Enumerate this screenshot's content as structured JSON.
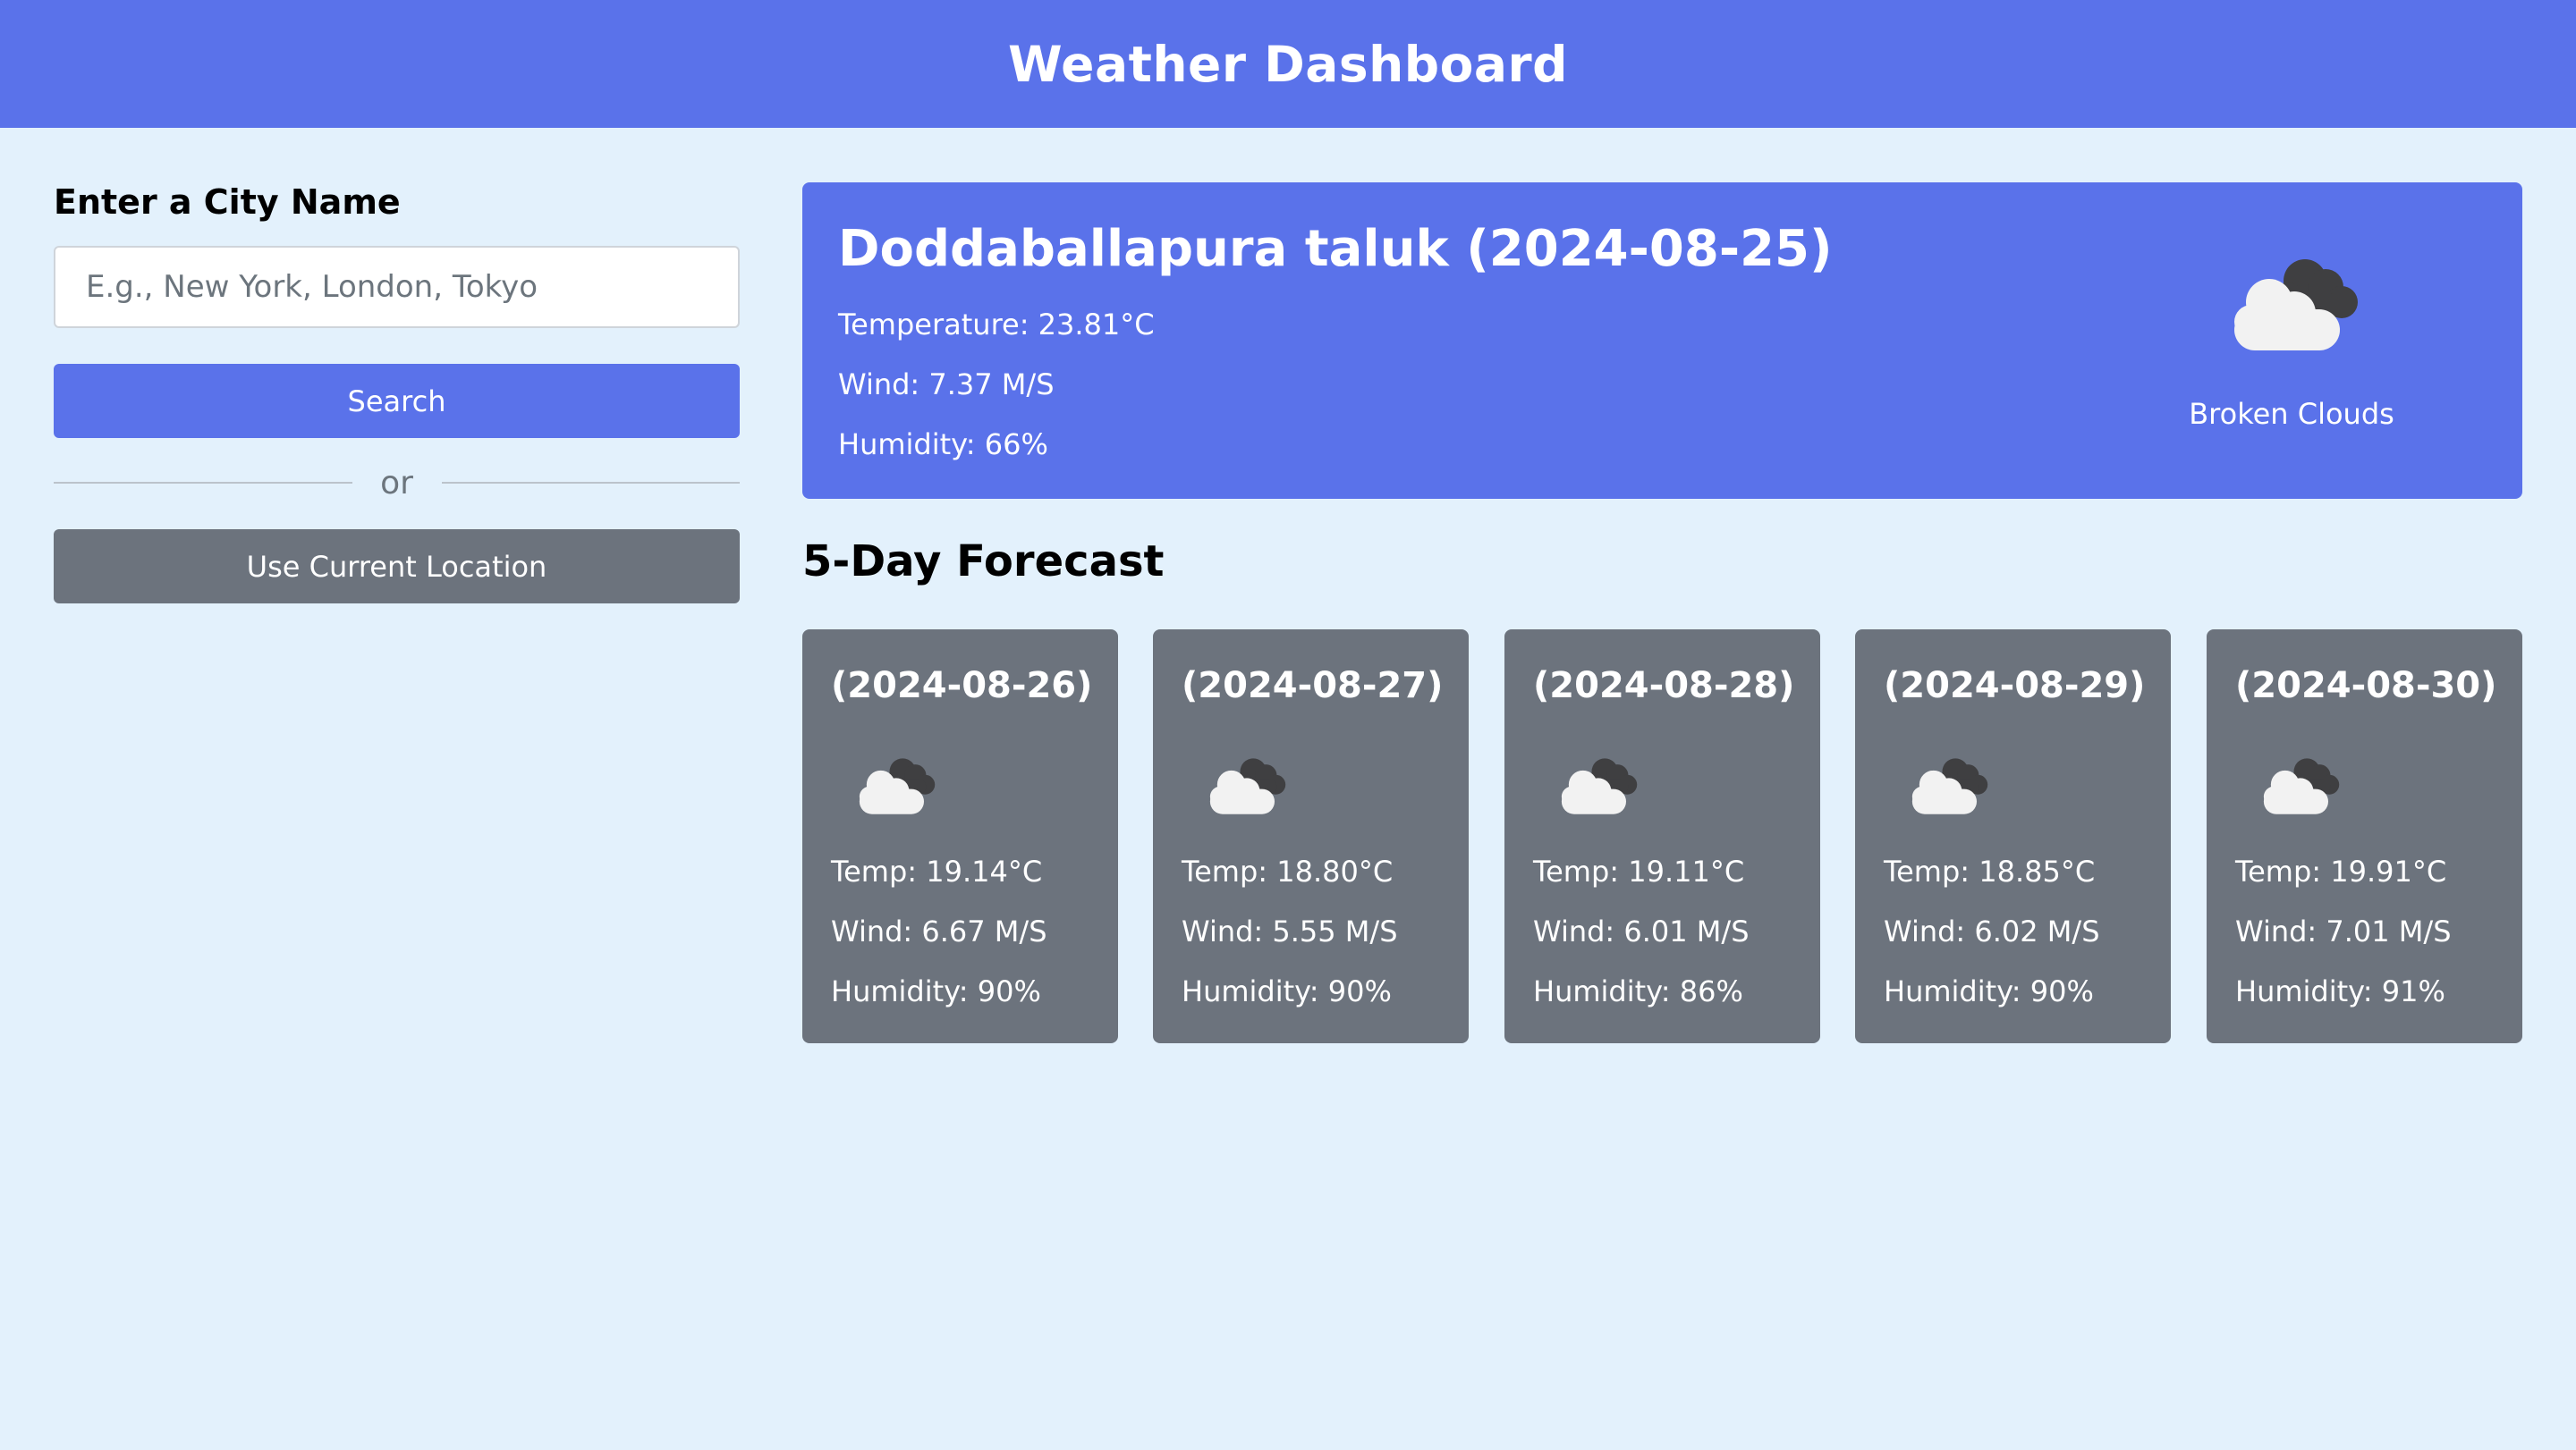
{
  "header": {
    "title": "Weather Dashboard"
  },
  "sidebar": {
    "label": "Enter a City Name",
    "input_placeholder": "E.g., New York, London, Tokyo",
    "input_value": "",
    "search_label": "Search",
    "divider_text": "or",
    "location_label": "Use Current Location"
  },
  "current": {
    "title": "Doddaballapura taluk (2024-08-25)",
    "temperature": "Temperature: 23.81°C",
    "wind": "Wind: 7.37 M/S",
    "humidity": "Humidity: 66%",
    "description": "Broken Clouds",
    "icon": "broken-clouds-icon"
  },
  "forecast": {
    "title": "5-Day Forecast",
    "days": [
      {
        "date": "(2024-08-26)",
        "temp": "Temp: 19.14°C",
        "wind": "Wind: 6.67 M/S",
        "humidity": "Humidity: 90%",
        "icon": "broken-clouds-icon"
      },
      {
        "date": "(2024-08-27)",
        "temp": "Temp: 18.80°C",
        "wind": "Wind: 5.55 M/S",
        "humidity": "Humidity: 90%",
        "icon": "broken-clouds-icon"
      },
      {
        "date": "(2024-08-28)",
        "temp": "Temp: 19.11°C",
        "wind": "Wind: 6.01 M/S",
        "humidity": "Humidity: 86%",
        "icon": "broken-clouds-icon"
      },
      {
        "date": "(2024-08-29)",
        "temp": "Temp: 18.85°C",
        "wind": "Wind: 6.02 M/S",
        "humidity": "Humidity: 90%",
        "icon": "broken-clouds-icon"
      },
      {
        "date": "(2024-08-30)",
        "temp": "Temp: 19.91°C",
        "wind": "Wind: 7.01 M/S",
        "humidity": "Humidity: 91%",
        "icon": "broken-clouds-icon"
      }
    ]
  },
  "colors": {
    "accent": "#5a72ea",
    "secondary": "#6c737d",
    "background": "#e3f1fc"
  }
}
